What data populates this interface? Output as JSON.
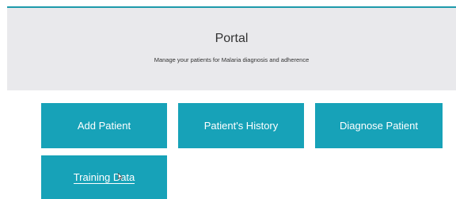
{
  "header": {
    "title": "Portal",
    "subtitle": "Manage your patients for Malaria diagnosis and adherence"
  },
  "tiles": [
    {
      "label": "Add Patient"
    },
    {
      "label": "Patient's History"
    },
    {
      "label": "Diagnose Patient"
    },
    {
      "label": "Training Data"
    }
  ],
  "colors": {
    "accent": "#17a2b8",
    "header_background": "#e9e9ec",
    "header_border": "#1e9aab"
  },
  "icons": {
    "cursor": "mouse-pointer-icon"
  }
}
